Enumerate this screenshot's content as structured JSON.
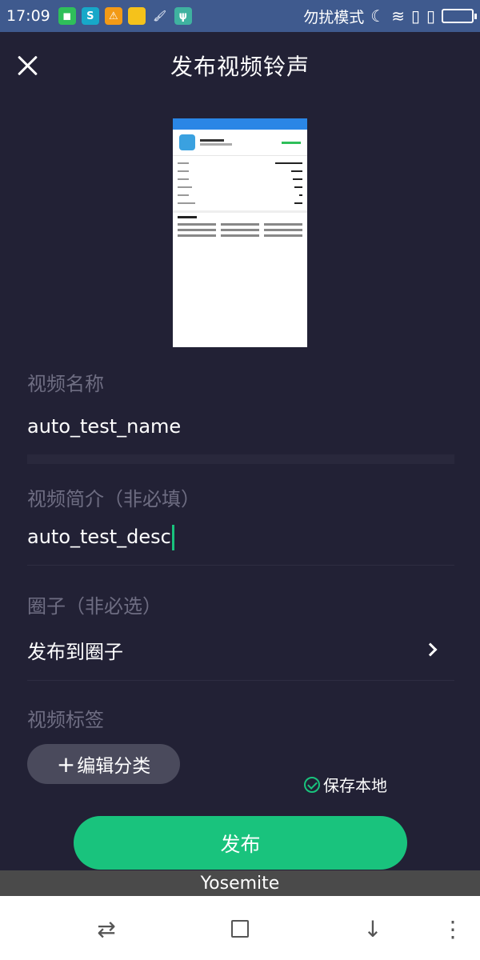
{
  "status_bar": {
    "time": "17:09",
    "notifications": [
      {
        "icon": "app-notification-icon",
        "color": "#2fbf5a"
      },
      {
        "icon": "sync-app-icon",
        "color": "#17a8c9"
      },
      {
        "icon": "warning-icon",
        "color": "#f39a16"
      },
      {
        "icon": "folder-icon",
        "color": "#f5c21b"
      },
      {
        "icon": "brush-icon",
        "color": "#c9d3e6"
      },
      {
        "icon": "usb-icon",
        "color": "#3fb2a0"
      }
    ],
    "mode_text": "勿扰模式",
    "icons": [
      "moon-icon",
      "wifi-icon",
      "sim1-icon",
      "sim2-icon",
      "battery-icon"
    ]
  },
  "header": {
    "title": "发布视频铃声",
    "close_icon": "close-icon"
  },
  "form": {
    "name_label": "视频名称",
    "name_value": "auto_test_name",
    "desc_label": "视频简介（非必填）",
    "desc_value": "auto_test_desc",
    "circle_label": "圈子（非必选）",
    "circle_value": "发布到圈子",
    "tags_label": "视频标签",
    "edit_tag_label": "编辑分类",
    "save_local_label": "保存本地",
    "publish_label": "发布"
  },
  "overlay": {
    "label": "Yosemite"
  },
  "nav": {
    "icons": [
      "switch-icon",
      "home-square-icon",
      "download-icon",
      "menu-icon"
    ]
  },
  "colors": {
    "background": "#222135",
    "accent": "#19c37d",
    "label": "#6e6d82",
    "status_bar": "#3f5a8e"
  }
}
